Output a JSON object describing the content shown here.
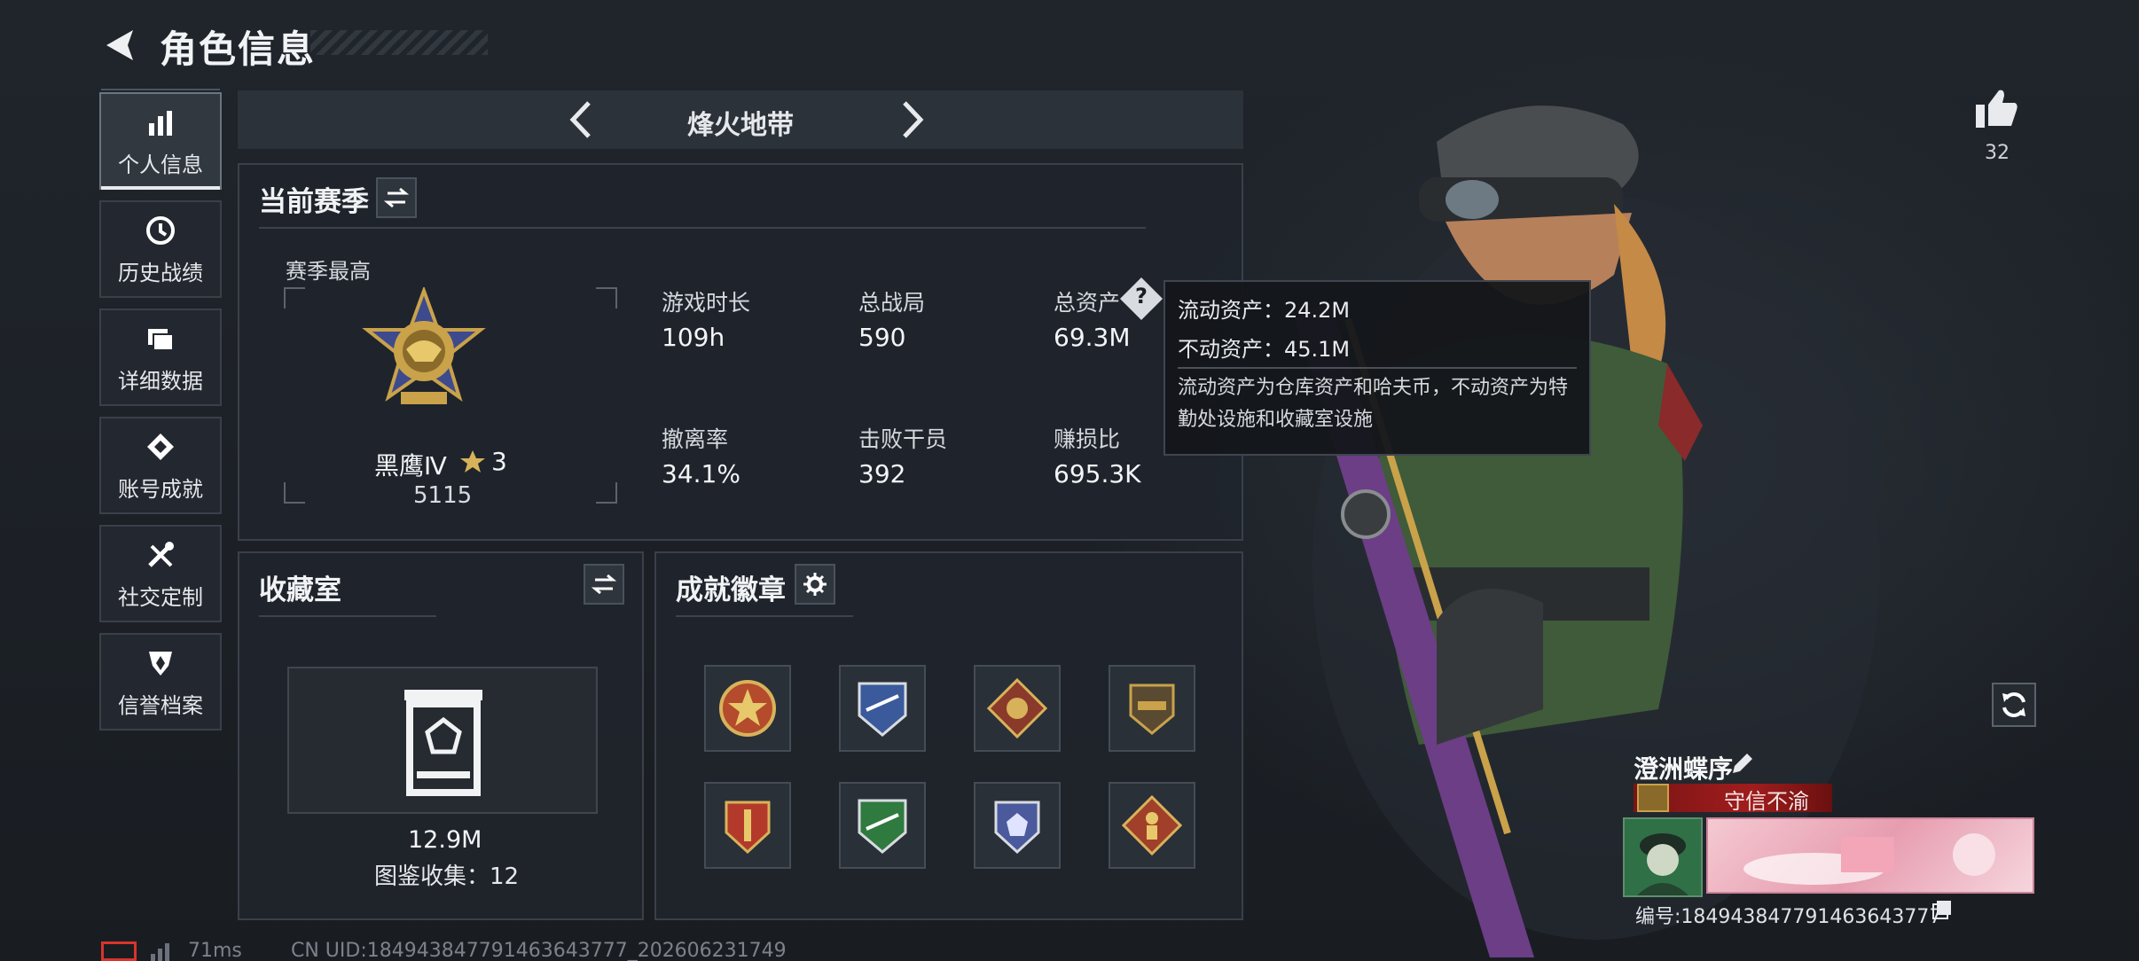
{
  "header": {
    "title": "角色信息"
  },
  "nav": [
    {
      "label": "个人信息",
      "icon": "bar-chart-icon"
    },
    {
      "label": "历史战绩",
      "icon": "history-icon"
    },
    {
      "label": "详细数据",
      "icon": "folder-icon"
    },
    {
      "label": "账号成就",
      "icon": "achievement-icon"
    },
    {
      "label": "社交定制",
      "icon": "tools-icon"
    },
    {
      "label": "信誉档案",
      "icon": "shield-icon"
    }
  ],
  "mode": {
    "title": "烽火地带"
  },
  "season": {
    "title": "当前赛季",
    "best_label": "赛季最高",
    "rank_name": "黑鹰Ⅳ",
    "rank_stars": "3",
    "rank_score": "5115",
    "stats": [
      {
        "label": "游戏时长",
        "value": "109h"
      },
      {
        "label": "总战局",
        "value": "590"
      },
      {
        "label": "总资产",
        "value": "69.3M"
      },
      {
        "label": "撤离率",
        "value": "34.1%"
      },
      {
        "label": "击败干员",
        "value": "392"
      },
      {
        "label": "赚损比",
        "value": "695.3K"
      }
    ]
  },
  "tooltip": {
    "line1": "流动资产：24.2M",
    "line2": "不动资产：45.1M",
    "desc": "流动资产为仓库资产和哈夫币，不动资产为特勤处设施和收藏室设施"
  },
  "collection": {
    "title": "收藏室",
    "value": "12.9M",
    "count_text": "图鉴收集：12"
  },
  "achievements": {
    "title": "成就徽章",
    "badges": [
      {
        "icon": "star-emblem-icon",
        "color": "#b34b2c"
      },
      {
        "icon": "wings-emblem-icon",
        "color": "#3a5a9c"
      },
      {
        "icon": "dragon-emblem-icon",
        "color": "#8a3a2a"
      },
      {
        "icon": "helicopter-emblem-icon",
        "color": "#8a6a3a"
      },
      {
        "icon": "sword-emblem-icon",
        "color": "#b33a2a"
      },
      {
        "icon": "plane-emblem-icon",
        "color": "#2f7a3f"
      },
      {
        "icon": "gem-emblem-icon",
        "color": "#4a5a9c"
      },
      {
        "icon": "runner-emblem-icon",
        "color": "#a0402a"
      }
    ]
  },
  "like": {
    "count": "32"
  },
  "profile": {
    "name": "澄洲蝶序",
    "tag": "守信不渝",
    "uid_label": "编号:1849438477914636437​77"
  },
  "footer": {
    "ping": "71ms",
    "uid": "CN UID:184943847791463643777_202606231749"
  }
}
